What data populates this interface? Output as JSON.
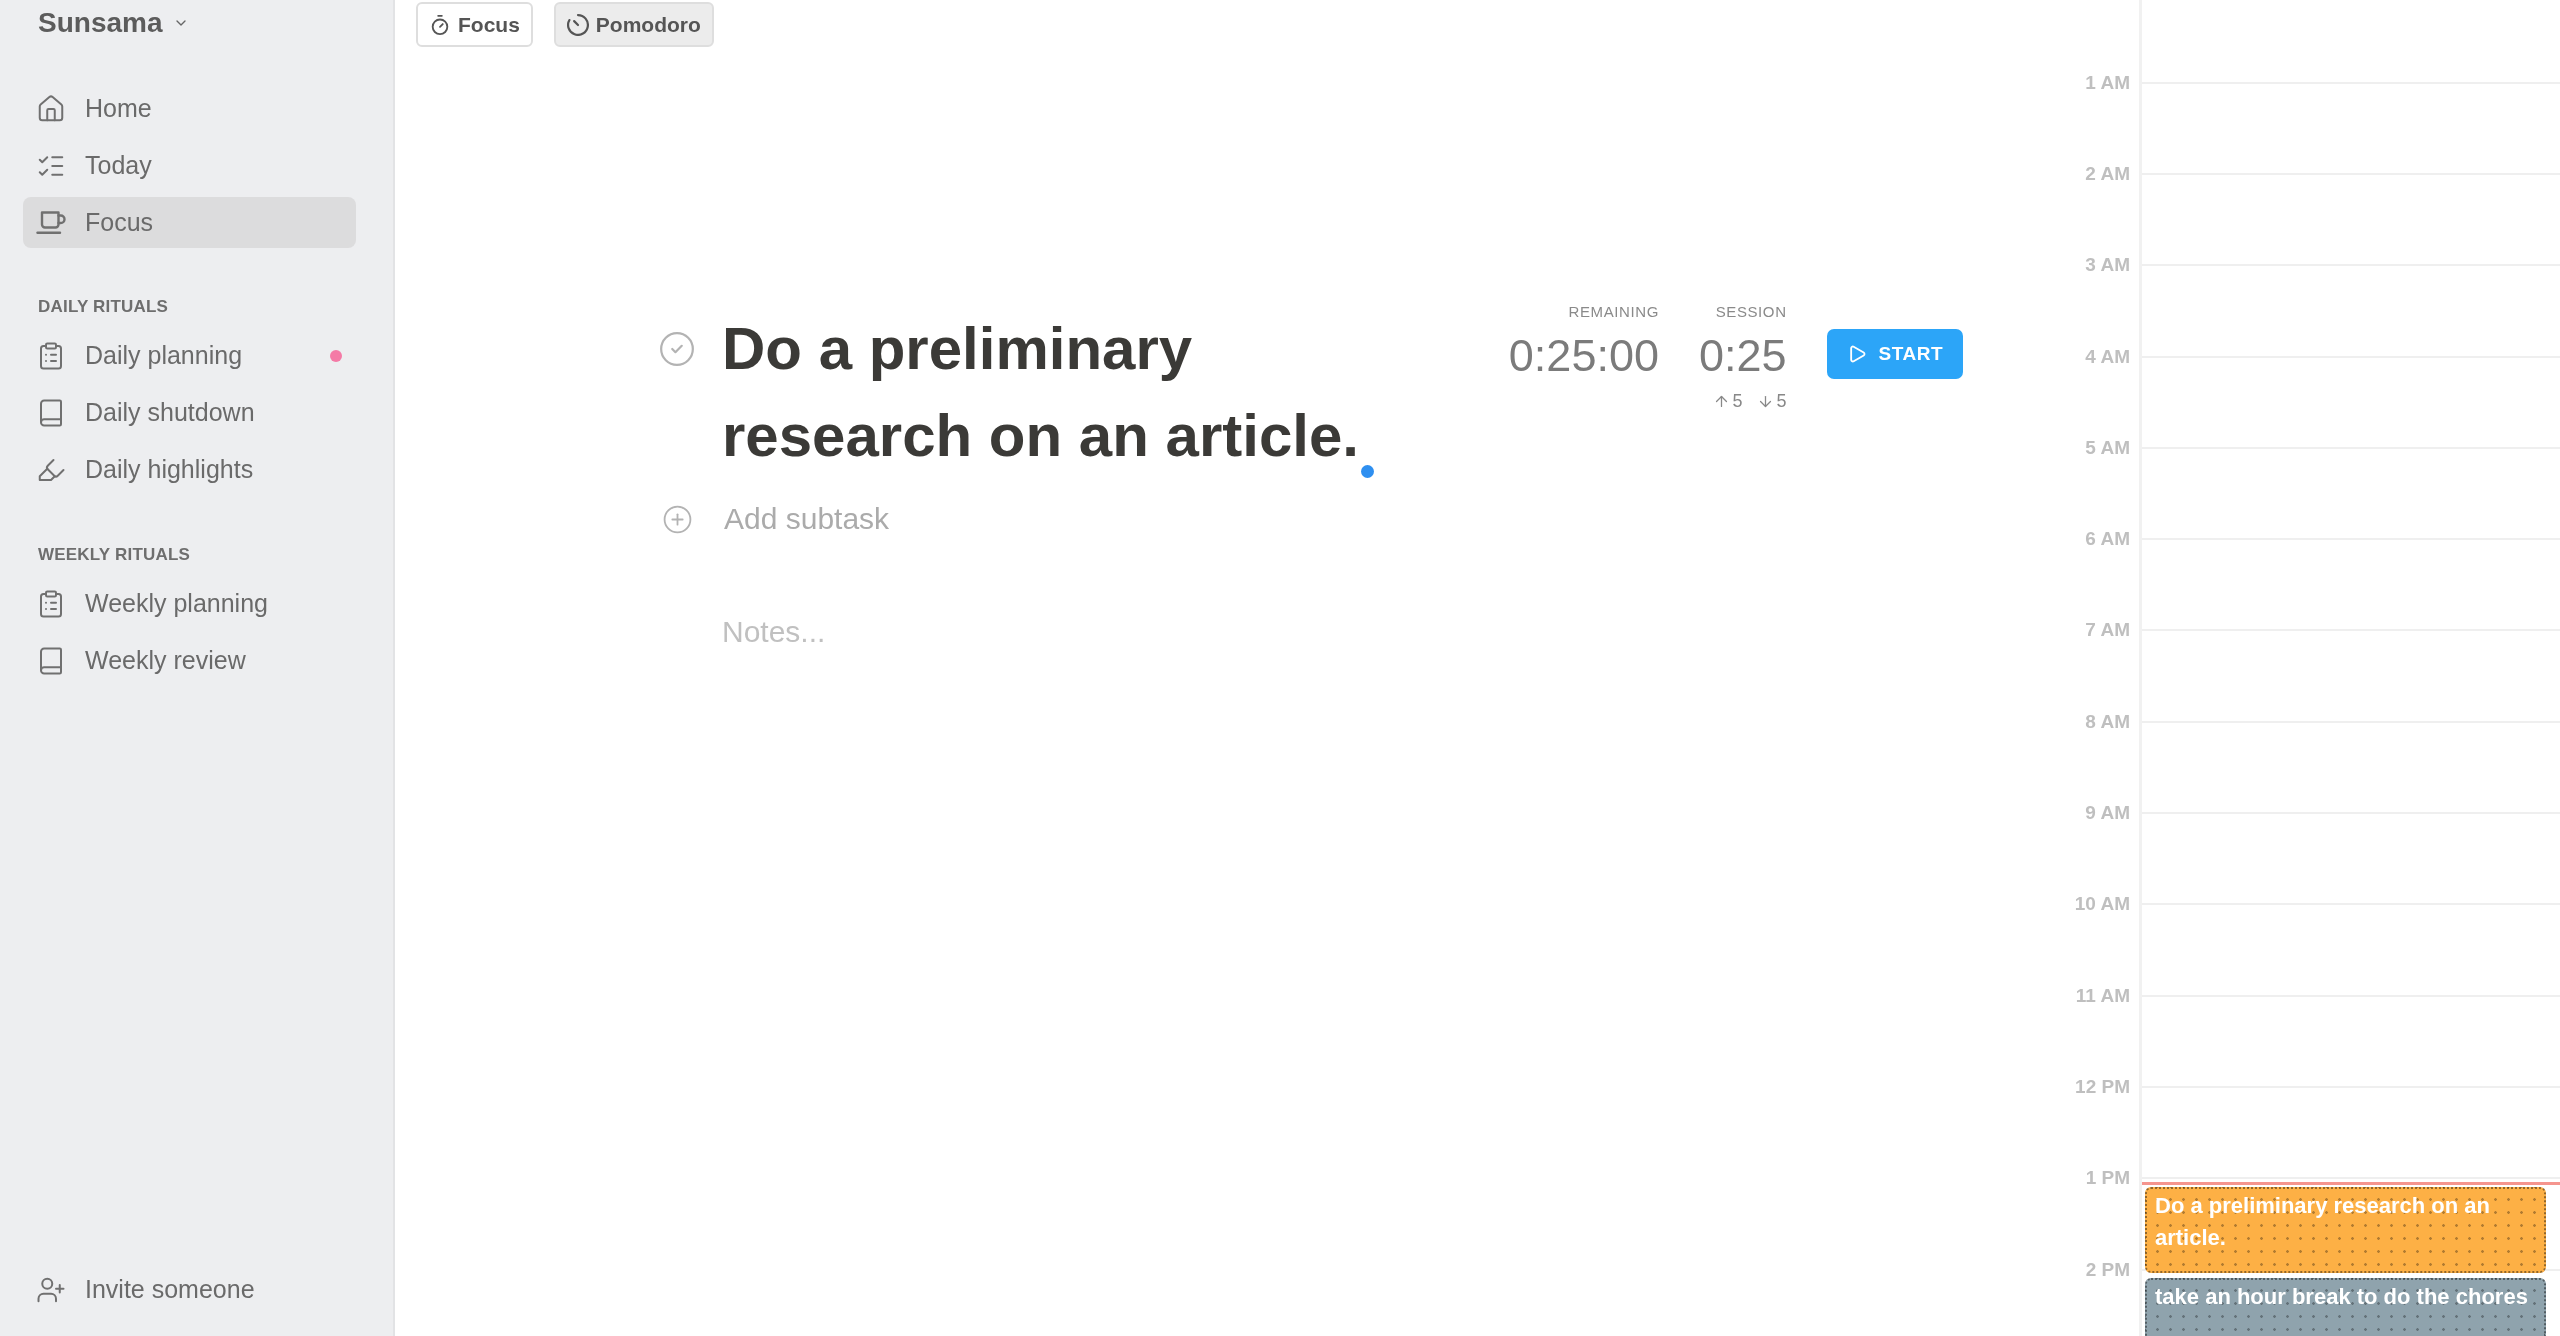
{
  "workspace": {
    "name": "Sunsama"
  },
  "nav": [
    {
      "label": "Home",
      "selected": false
    },
    {
      "label": "Today",
      "selected": false
    },
    {
      "label": "Focus",
      "selected": true
    }
  ],
  "sections": [
    {
      "title": "DAILY RITUALS",
      "items": [
        {
          "label": "Daily planning",
          "alert": true
        },
        {
          "label": "Daily shutdown",
          "alert": false
        },
        {
          "label": "Daily highlights",
          "alert": false
        }
      ]
    },
    {
      "title": "WEEKLY RITUALS",
      "items": [
        {
          "label": "Weekly planning",
          "alert": false
        },
        {
          "label": "Weekly review",
          "alert": false
        }
      ]
    }
  ],
  "invite": {
    "label": "Invite someone"
  },
  "mode_tabs": [
    {
      "label": "Focus",
      "selected": false
    },
    {
      "label": "Pomodoro",
      "selected": true
    }
  ],
  "task": {
    "title": "Do a preliminary research on an article.",
    "completed": false,
    "add_subtask": "Add subtask",
    "notes": {
      "placeholder": "Notes..."
    }
  },
  "timer": {
    "remaining_label": "REMAINING",
    "remaining": "0:25:00",
    "session_label": "SESSION",
    "session": "0:25",
    "increase": "5",
    "decrease": "5",
    "start_button": "START"
  },
  "calendar": {
    "hours": [
      "1 AM",
      "2 AM",
      "3 AM",
      "4 AM",
      "5 AM",
      "6 AM",
      "7 AM",
      "8 AM",
      "9 AM",
      "10 AM",
      "11 AM",
      "12 PM",
      "1 PM",
      "2 PM"
    ],
    "events": [
      {
        "title": "Do a preliminary research on an article.",
        "color": "#fdb045"
      },
      {
        "title": "take an hour break to do the chores",
        "color": "#8fa3ad"
      }
    ]
  }
}
